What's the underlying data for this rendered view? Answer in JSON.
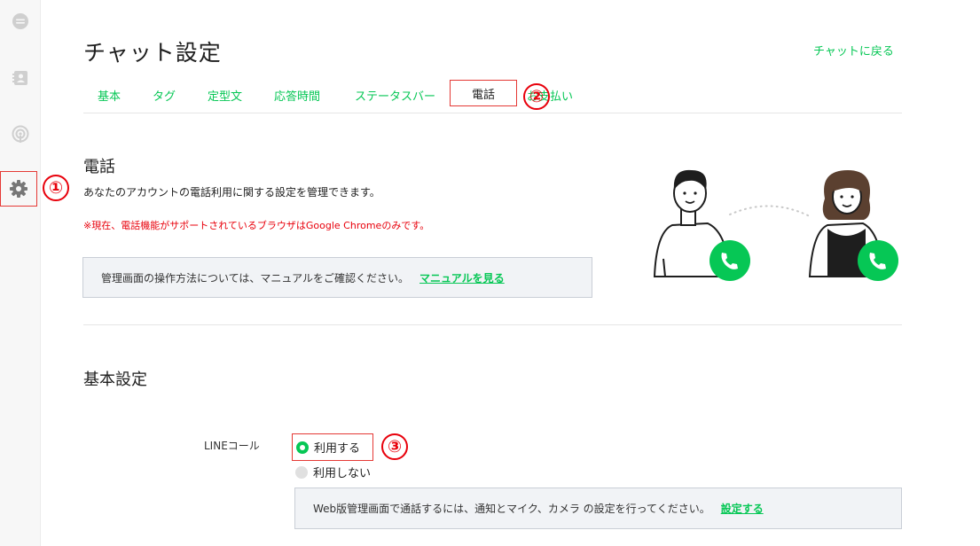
{
  "page": {
    "title": "チャット設定",
    "back_link": "チャットに戻る"
  },
  "sidebar": {
    "items": [
      {
        "icon": "chat-icon"
      },
      {
        "icon": "contact-icon"
      },
      {
        "icon": "broadcast-icon"
      },
      {
        "icon": "gear-icon"
      }
    ]
  },
  "tabs": [
    {
      "label": "基本"
    },
    {
      "label": "タグ"
    },
    {
      "label": "定型文"
    },
    {
      "label": "応答時間"
    },
    {
      "label": "ステータスバー"
    },
    {
      "label": "電話",
      "selected": true
    },
    {
      "label": "お支払い"
    }
  ],
  "phone": {
    "section_title": "電話",
    "description": "あなたのアカウントの電話利用に関する設定を管理できます。",
    "notice": "※現在、電話機能がサポートされているブラウザはGoogle Chromeのみです。",
    "manual_text": "管理画面の操作方法については、マニュアルをご確認ください。",
    "manual_link": "マニュアルを見る"
  },
  "basic": {
    "title": "基本設定",
    "line_call_label": "LINEコール",
    "options": [
      {
        "label": "利用する",
        "checked": true
      },
      {
        "label": "利用しない",
        "checked": false
      }
    ],
    "setting_text": "Web版管理画面で通話するには、通知とマイク、カメラ の設定を行ってください。",
    "setting_link": "設定する"
  },
  "markers": [
    "①",
    "②",
    "③"
  ],
  "colors": {
    "accent": "#06c755",
    "annotation": "#e8000b"
  }
}
